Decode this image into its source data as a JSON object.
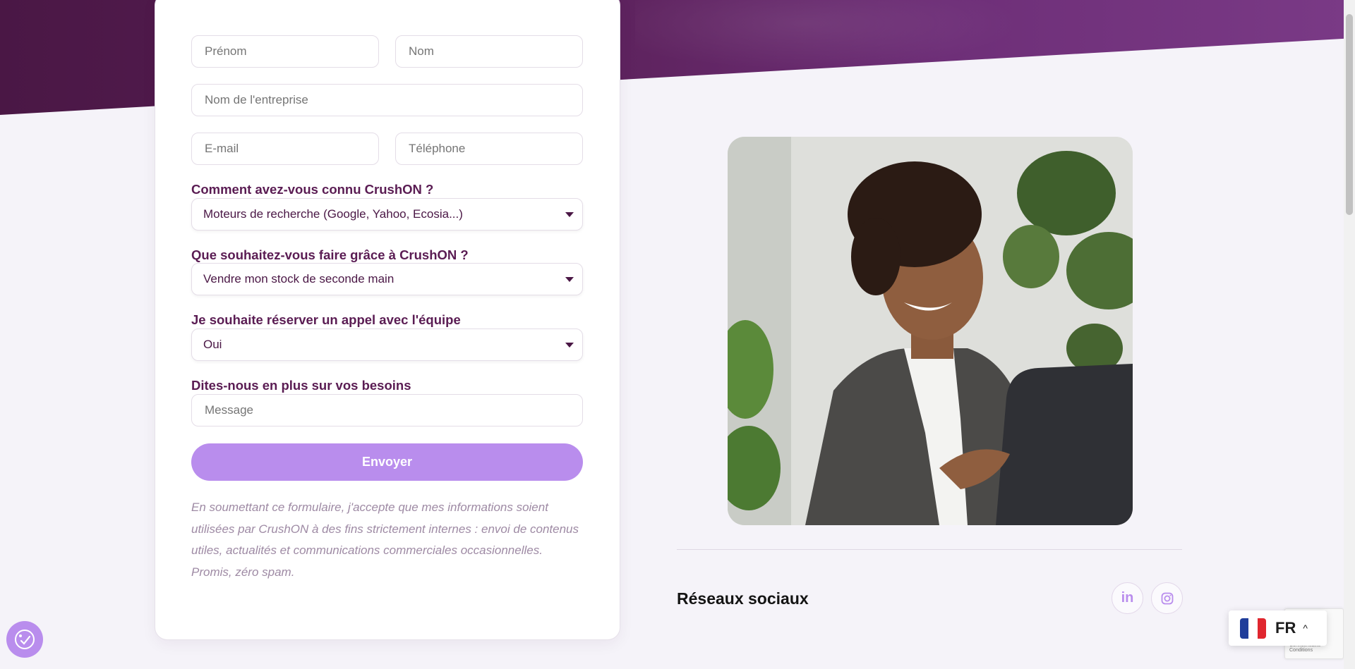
{
  "form": {
    "first_name_placeholder": "Prénom",
    "last_name_placeholder": "Nom",
    "company_placeholder": "Nom de l'entreprise",
    "email_placeholder": "E-mail",
    "phone_placeholder": "Téléphone",
    "source_label": "Comment avez-vous connu CrushON ?",
    "source_value": "Moteurs de recherche (Google, Yahoo, Ecosia...)",
    "goal_label": "Que souhaitez-vous faire grâce à CrushON ?",
    "goal_value": "Vendre mon stock de seconde main",
    "call_label": "Je souhaite réserver un appel avec l'équipe",
    "call_value": "Oui",
    "needs_label": "Dites-nous en plus sur vos besoins",
    "message_placeholder": "Message",
    "submit_label": "Envoyer",
    "legal_text": "En soumettant ce formulaire, j'accepte que mes informations soient utilisées par CrushON à des fins strictement internes : envoi de contenus utiles, actualités et communications commerciales occasionnelles. Promis, zéro spam."
  },
  "social": {
    "title": "Réseaux sociaux",
    "linkedin_icon": "linkedin-icon",
    "instagram_icon": "instagram-icon"
  },
  "language": {
    "code": "FR",
    "flag": "france-flag-icon"
  },
  "recaptcha": {
    "text": "Confidentialité - Conditions"
  },
  "colors": {
    "brand_dark": "#4a1745",
    "accent_purple": "#b98ded",
    "label_purple": "#5a1c53",
    "placeholder": "#b58ac0"
  }
}
